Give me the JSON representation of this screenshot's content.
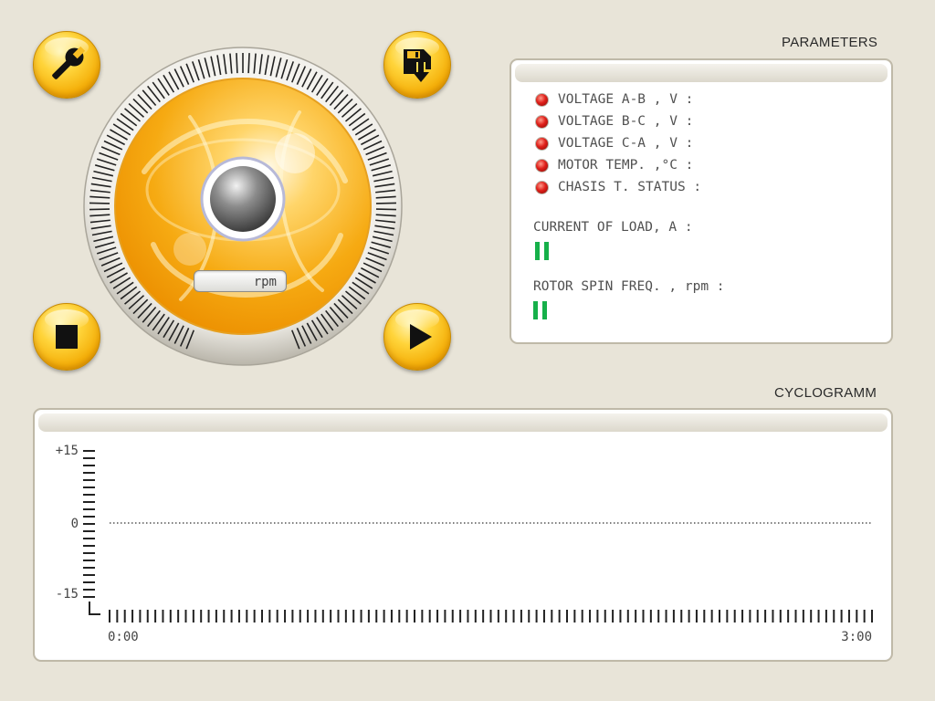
{
  "colors": {
    "background": "#e8e4d8",
    "accent": "#f7b51b",
    "led_red": "#e0201a",
    "meter_green": "#16b04a"
  },
  "toolbar": {
    "settings_icon": "wrench-icon",
    "save_icon": "floppy-download-icon",
    "stop_icon": "stop-icon",
    "play_icon": "play-icon"
  },
  "dial": {
    "rpm_value": "",
    "rpm_unit": "rpm"
  },
  "parameters": {
    "title": "PARAMETERS",
    "indicators": [
      {
        "label": "VOLTAGE A-B , V :",
        "status": "red"
      },
      {
        "label": "VOLTAGE B-C , V :",
        "status": "red"
      },
      {
        "label": "VOLTAGE C-A , V :",
        "status": "red"
      },
      {
        "label": "MOTOR TEMP. ,°C :",
        "status": "red"
      },
      {
        "label": "CHASIS T. STATUS :",
        "status": "red"
      }
    ],
    "current_label": "CURRENT OF LOAD, A :",
    "current_segments": 2,
    "rotor_label": "ROTOR SPIN FREQ. , rpm :",
    "rotor_segments": 2
  },
  "cyclogramm": {
    "title": "CYCLOGRAMM",
    "y_labels": [
      "+15",
      "0",
      "-15"
    ],
    "x_labels": [
      "0:00",
      "3:00"
    ]
  },
  "chart_data": {
    "type": "line",
    "title": "CYCLOGRAMM",
    "x_tick_labels": [
      "0:00",
      "3:00"
    ],
    "y_tick_labels": [
      "+15",
      "0",
      "-15"
    ],
    "ylim": [
      -15,
      15
    ],
    "xlim": [
      "0:00",
      "3:00"
    ],
    "series": [],
    "reference_lines": [
      {
        "y": 0,
        "style": "dotted"
      }
    ],
    "grid": false
  }
}
